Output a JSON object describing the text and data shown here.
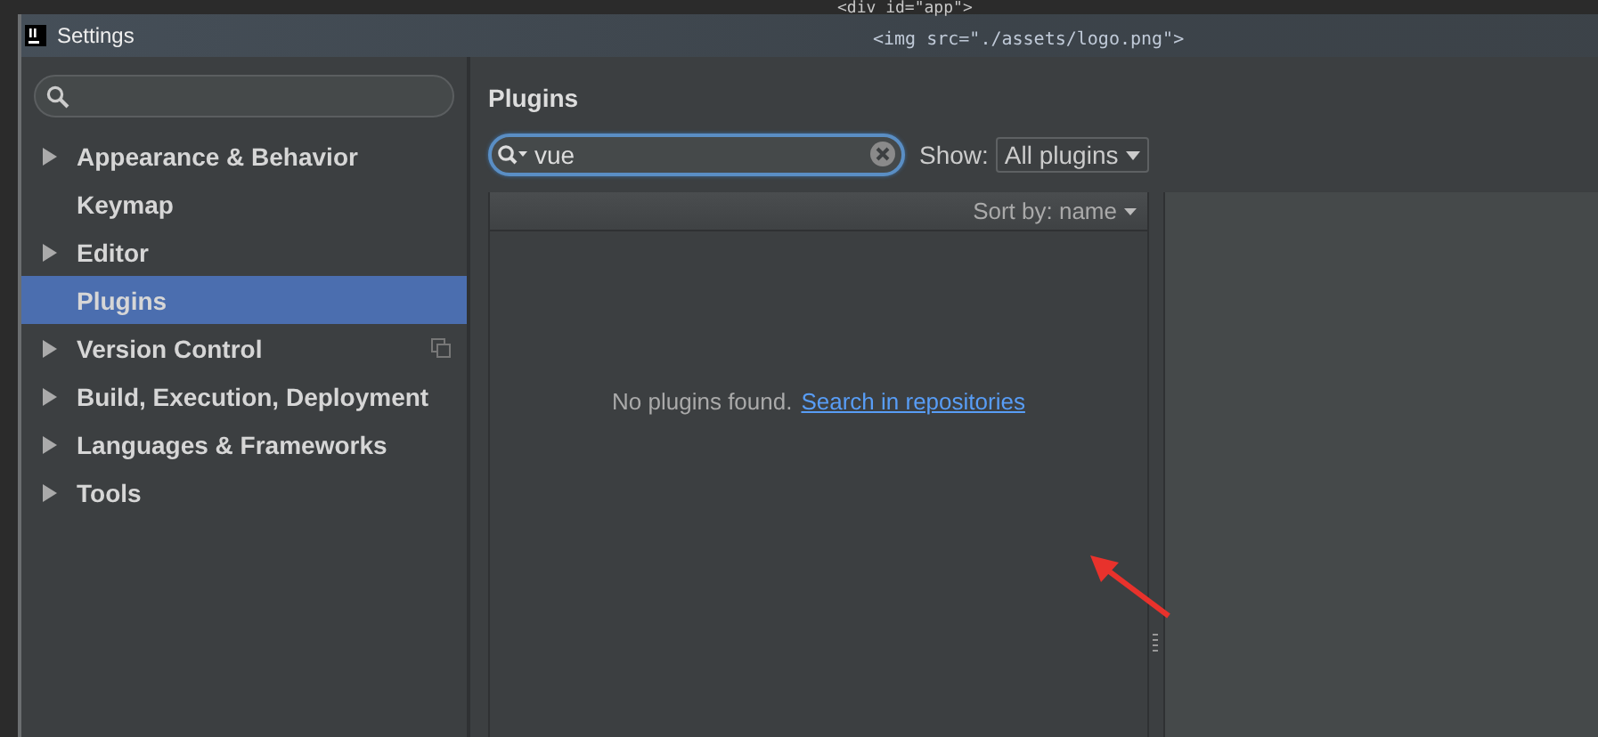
{
  "background_editor": {
    "code_lines": [
      "<div id=\"app\">",
      "<img src=\"./assets/logo.png\">"
    ]
  },
  "window": {
    "title": "Settings"
  },
  "sidebar": {
    "items": [
      {
        "label": "Appearance & Behavior",
        "expandable": true,
        "selected": false,
        "shared": false
      },
      {
        "label": "Keymap",
        "expandable": false,
        "selected": false,
        "shared": false
      },
      {
        "label": "Editor",
        "expandable": true,
        "selected": false,
        "shared": false
      },
      {
        "label": "Plugins",
        "expandable": false,
        "selected": true,
        "shared": false
      },
      {
        "label": "Version Control",
        "expandable": true,
        "selected": false,
        "shared": true
      },
      {
        "label": "Build, Execution, Deployment",
        "expandable": true,
        "selected": false,
        "shared": false
      },
      {
        "label": "Languages & Frameworks",
        "expandable": true,
        "selected": false,
        "shared": false
      },
      {
        "label": "Tools",
        "expandable": true,
        "selected": false,
        "shared": false
      }
    ]
  },
  "plugins": {
    "title": "Plugins",
    "search": {
      "value": "vue"
    },
    "show_label": "Show:",
    "show_value": "All plugins",
    "sort_label": "Sort by: name",
    "empty_message": "No plugins found.",
    "search_link": "Search in repositories"
  }
}
